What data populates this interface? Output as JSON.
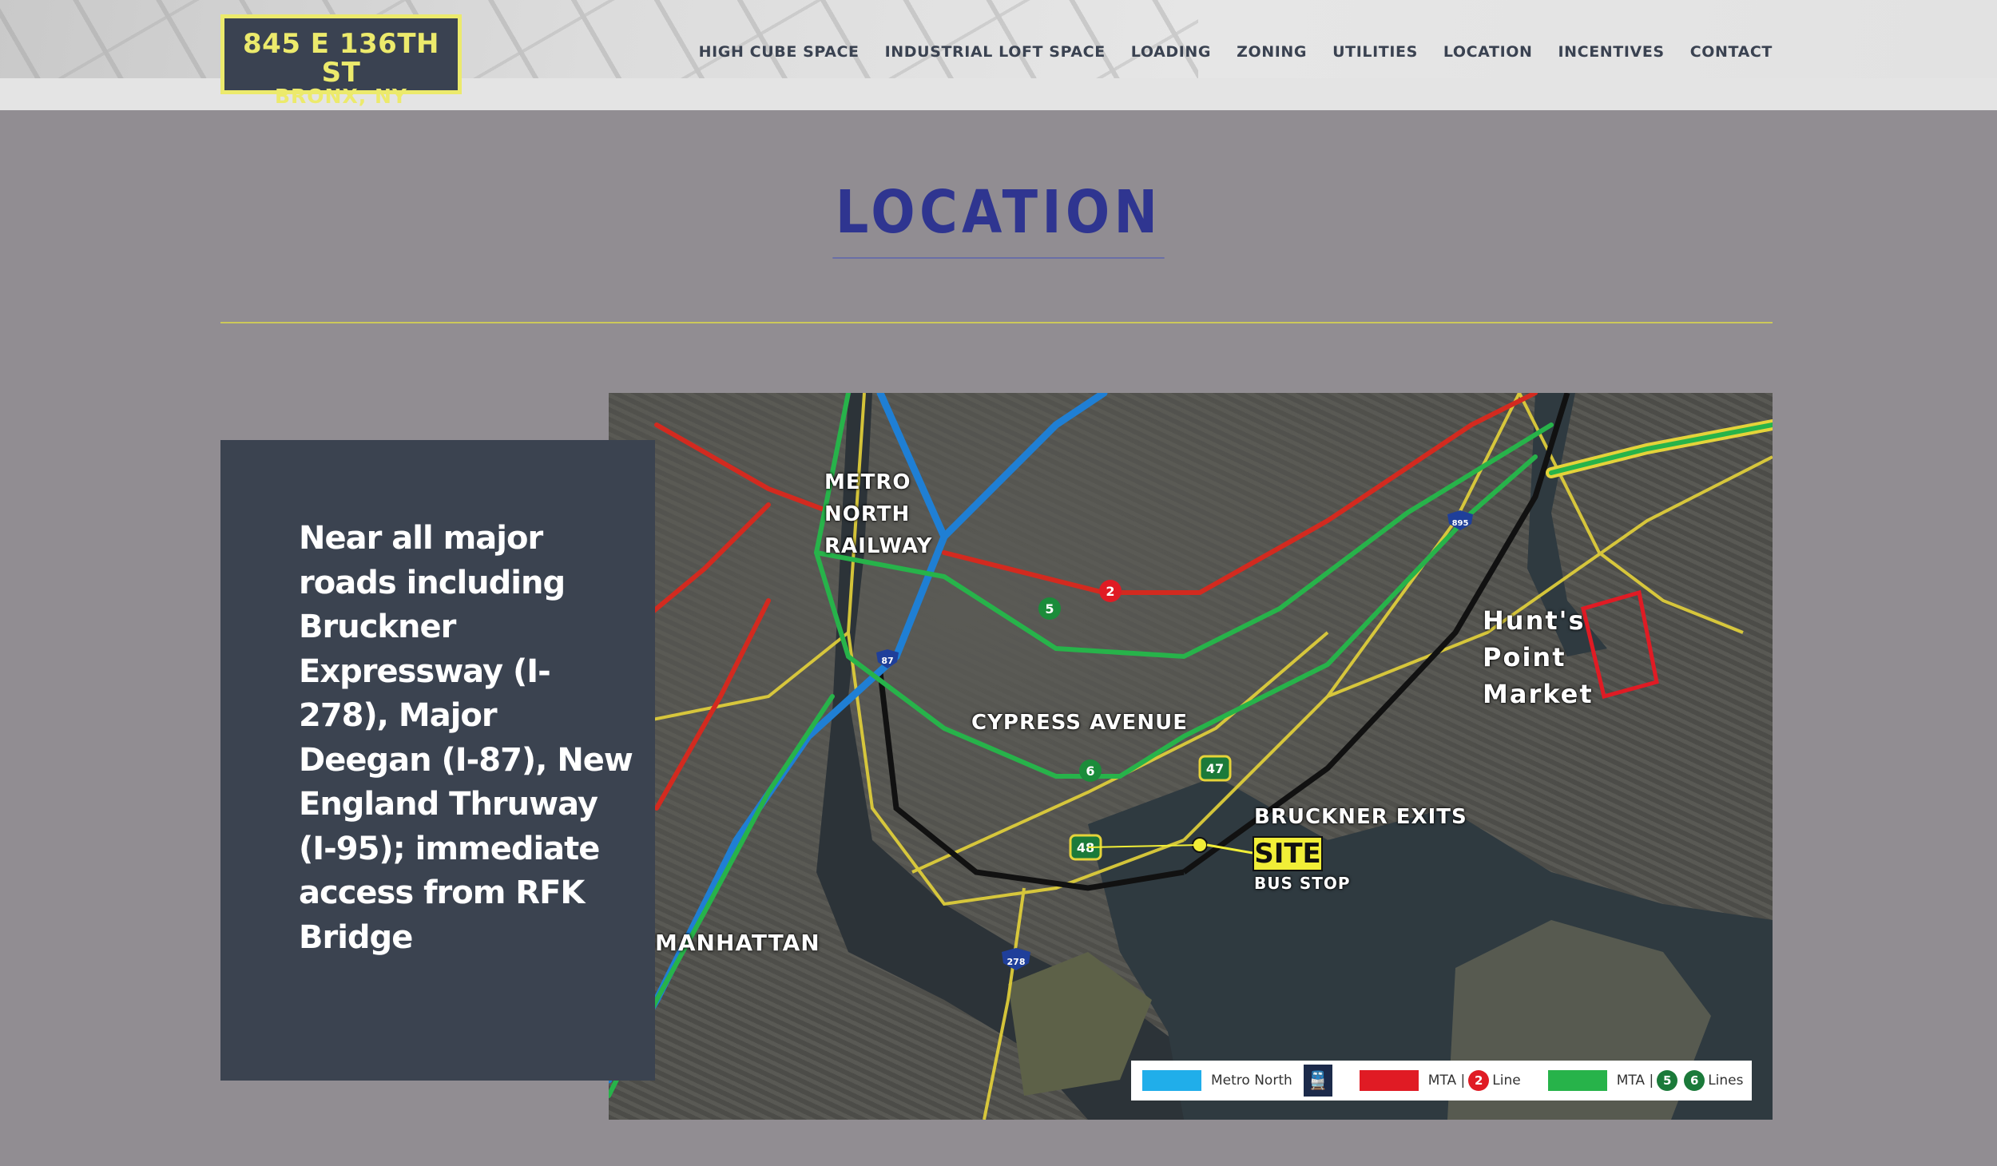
{
  "header": {
    "logo_line1": "845 E 136TH ST",
    "logo_line2": "BRONX, NY",
    "nav": [
      "HIGH CUBE SPACE",
      "INDUSTRIAL LOFT SPACE",
      "LOADING",
      "ZONING",
      "UTILITIES",
      "LOCATION",
      "INCENTIVES",
      "CONTACT"
    ]
  },
  "section": {
    "title": "LOCATION",
    "description": "Near all major roads including Bruckner Expressway (I-278), Major Deegan (I-87), New England Thruway (I-95); immediate access from RFK Bridge"
  },
  "map": {
    "labels": {
      "metro_north": [
        "METRO",
        "NORTH",
        "RAILWAY"
      ],
      "cypress": "CYPRESS AVENUE",
      "hunts_point": [
        "Hunt's",
        "Point",
        "Market"
      ],
      "bruckner": "BRUCKNER EXITS",
      "site": "SITE",
      "bus_stop": "BUS STOP",
      "manhattan": "MANHATTAN"
    },
    "route_markers": [
      "2",
      "5",
      "6",
      "47",
      "48",
      "87",
      "278",
      "895"
    ],
    "legend": {
      "metro_north": "Metro North",
      "mta2_prefix": "MTA |",
      "mta2_num": "2",
      "mta2_suffix": "Line",
      "mta56_prefix": "MTA |",
      "mta56_num1": "5",
      "mta56_num2": "6",
      "mta56_suffix": "Lines"
    },
    "colors": {
      "metro_north": "#1f9be6",
      "mta_2": "#e01b24",
      "mta_56": "#27b34a",
      "site": "#f1ee37",
      "highway": "#e5d33a"
    }
  }
}
